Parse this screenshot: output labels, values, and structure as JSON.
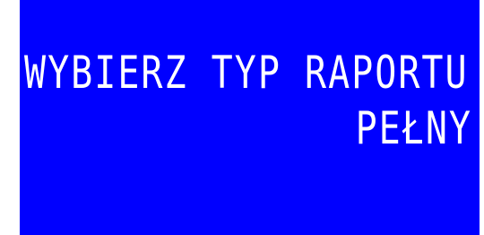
{
  "display": {
    "prompt": "WYBIERZ TYP RAPORTU",
    "selected_option": "PEŁNY",
    "background_color": "#0000ff",
    "text_color": "#ffffff"
  }
}
